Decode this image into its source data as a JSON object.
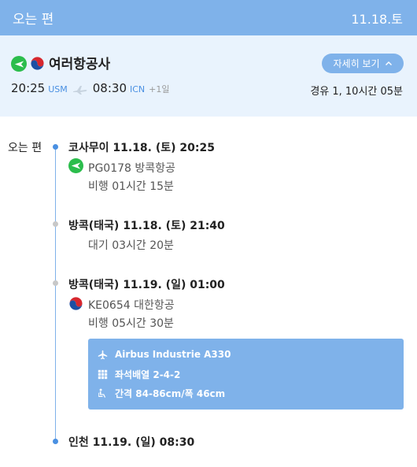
{
  "header": {
    "title": "오는 편",
    "date": "11.18.토"
  },
  "summary": {
    "airline": "여러항공사",
    "detail_button": "자세히 보기",
    "depart_time": "20:25",
    "depart_code": "USM",
    "arrive_time": "08:30",
    "arrive_code": "ICN",
    "day_offset": "+1일",
    "stops_duration": "경유 1, 10시간 05분"
  },
  "timeline": {
    "label": "오는 편",
    "stops": [
      {
        "title": "코사무이 11.18. (토) 20:25"
      },
      {
        "title": "방콕(태국) 11.18. (토) 21:40"
      },
      {
        "title": "방콕(태국) 11.19. (일) 01:00"
      },
      {
        "title": "인천 11.19. (일) 08:30"
      }
    ],
    "segments": [
      {
        "flight": "PG0178 방콕항공",
        "duration": "비행 01시간 15분"
      },
      {
        "layover": "대기 03시간 20분"
      },
      {
        "flight": "KE0654 대한항공",
        "duration": "비행 05시간 30분"
      }
    ],
    "aircraft": {
      "model": "Airbus Industrie A330",
      "seats": "좌석배열 2-4-2",
      "pitch": "간격 84-86cm/폭 46cm"
    }
  },
  "colors": {
    "accent": "#7fb2ea",
    "accent_dark": "#4a90e2",
    "summary_bg": "#e9f3fd",
    "bangkok_air": "#2bbd4c"
  },
  "icons": {
    "bangkok_airways_logo": "bangkok-airways-logo-icon",
    "korean_air_logo": "korean-air-logo-icon",
    "plane": "plane-icon",
    "chevron": "chevron-up-icon",
    "seat_grid": "seat-grid-icon",
    "legroom": "legroom-seat-icon"
  }
}
